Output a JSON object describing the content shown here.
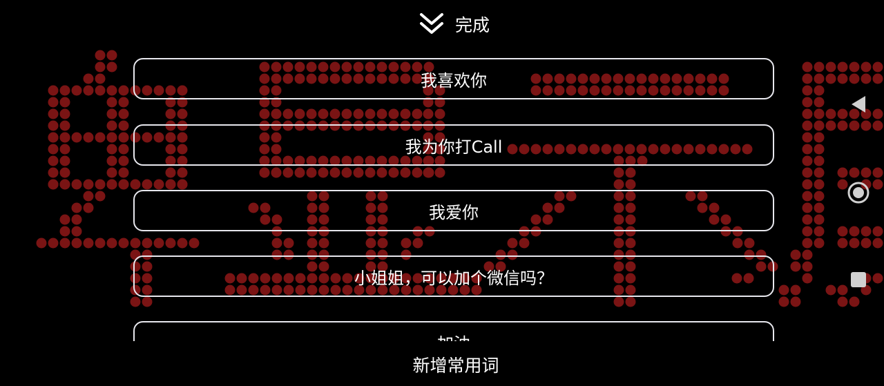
{
  "header": {
    "done_label": "完成",
    "collapse_icon": "double-chevron-down-icon"
  },
  "phrases": [
    {
      "label": "我喜欢你"
    },
    {
      "label": "我为你打Call"
    },
    {
      "label": "我爱你"
    },
    {
      "label": "小姐姐，可以加个微信吗？"
    },
    {
      "label": "加油"
    }
  ],
  "footer": {
    "add_label": "新增常用词"
  },
  "system_nav": {
    "back_icon": "back-triangle-icon",
    "home_icon": "home-circle-icon",
    "recents_icon": "recents-square-icon"
  },
  "colors": {
    "background": "#000000",
    "led_dot": "#7a1414",
    "text": "#ffffff",
    "border": "#e8e8ee",
    "nav_icon": "#d0d0d0"
  }
}
